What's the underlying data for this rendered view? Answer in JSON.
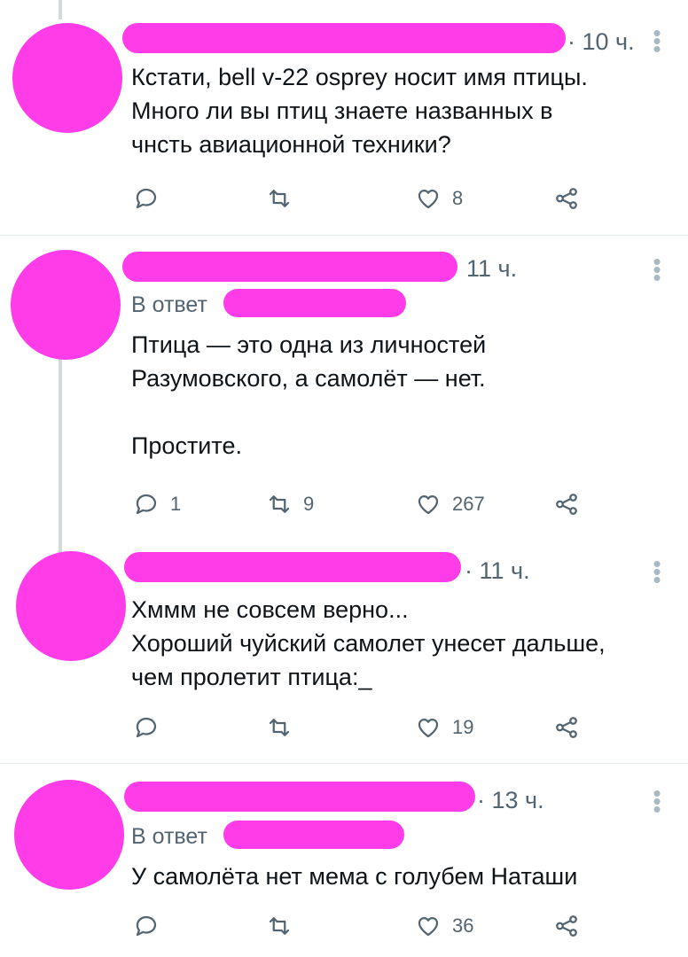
{
  "tweets": [
    {
      "time": "· 10 ч.",
      "reply_to": "",
      "lines": [
        "Кстати, bell v-22 osprey носит имя птицы.",
        "Много ли вы птиц знаете названных в",
        "чнсть авиационной техники?"
      ],
      "replies": "",
      "retweets": "",
      "likes": "8"
    },
    {
      "time": "11 ч.",
      "reply_to": "В ответ",
      "lines": [
        "Птица — это одна из личностей",
        "Разумовского, а самолёт — нет.",
        "",
        "Простите."
      ],
      "replies": "1",
      "retweets": "9",
      "likes": "267"
    },
    {
      "time": "· 11 ч.",
      "reply_to": "",
      "lines": [
        "Хммм не совсем верно...",
        "Хороший чуйский самолет унесет дальше,",
        "чем пролетит птица:_"
      ],
      "replies": "",
      "retweets": "",
      "likes": "19"
    },
    {
      "time": "· 13 ч.",
      "reply_to": "В ответ",
      "lines": [
        "У самолёта нет мема с голубем Наташи"
      ],
      "replies": "",
      "retweets": "",
      "likes": "36"
    }
  ],
  "icons": {
    "reply": "reply-icon",
    "retweet": "retweet-icon",
    "like": "heart-icon",
    "share": "share-icon",
    "more": "more-vertical-icon"
  },
  "colors": {
    "redaction": "#ff3ce8",
    "text": "#0f1419",
    "secondary": "#536471",
    "divider": "#e6ecf0",
    "thread_line": "#cfd9de"
  }
}
